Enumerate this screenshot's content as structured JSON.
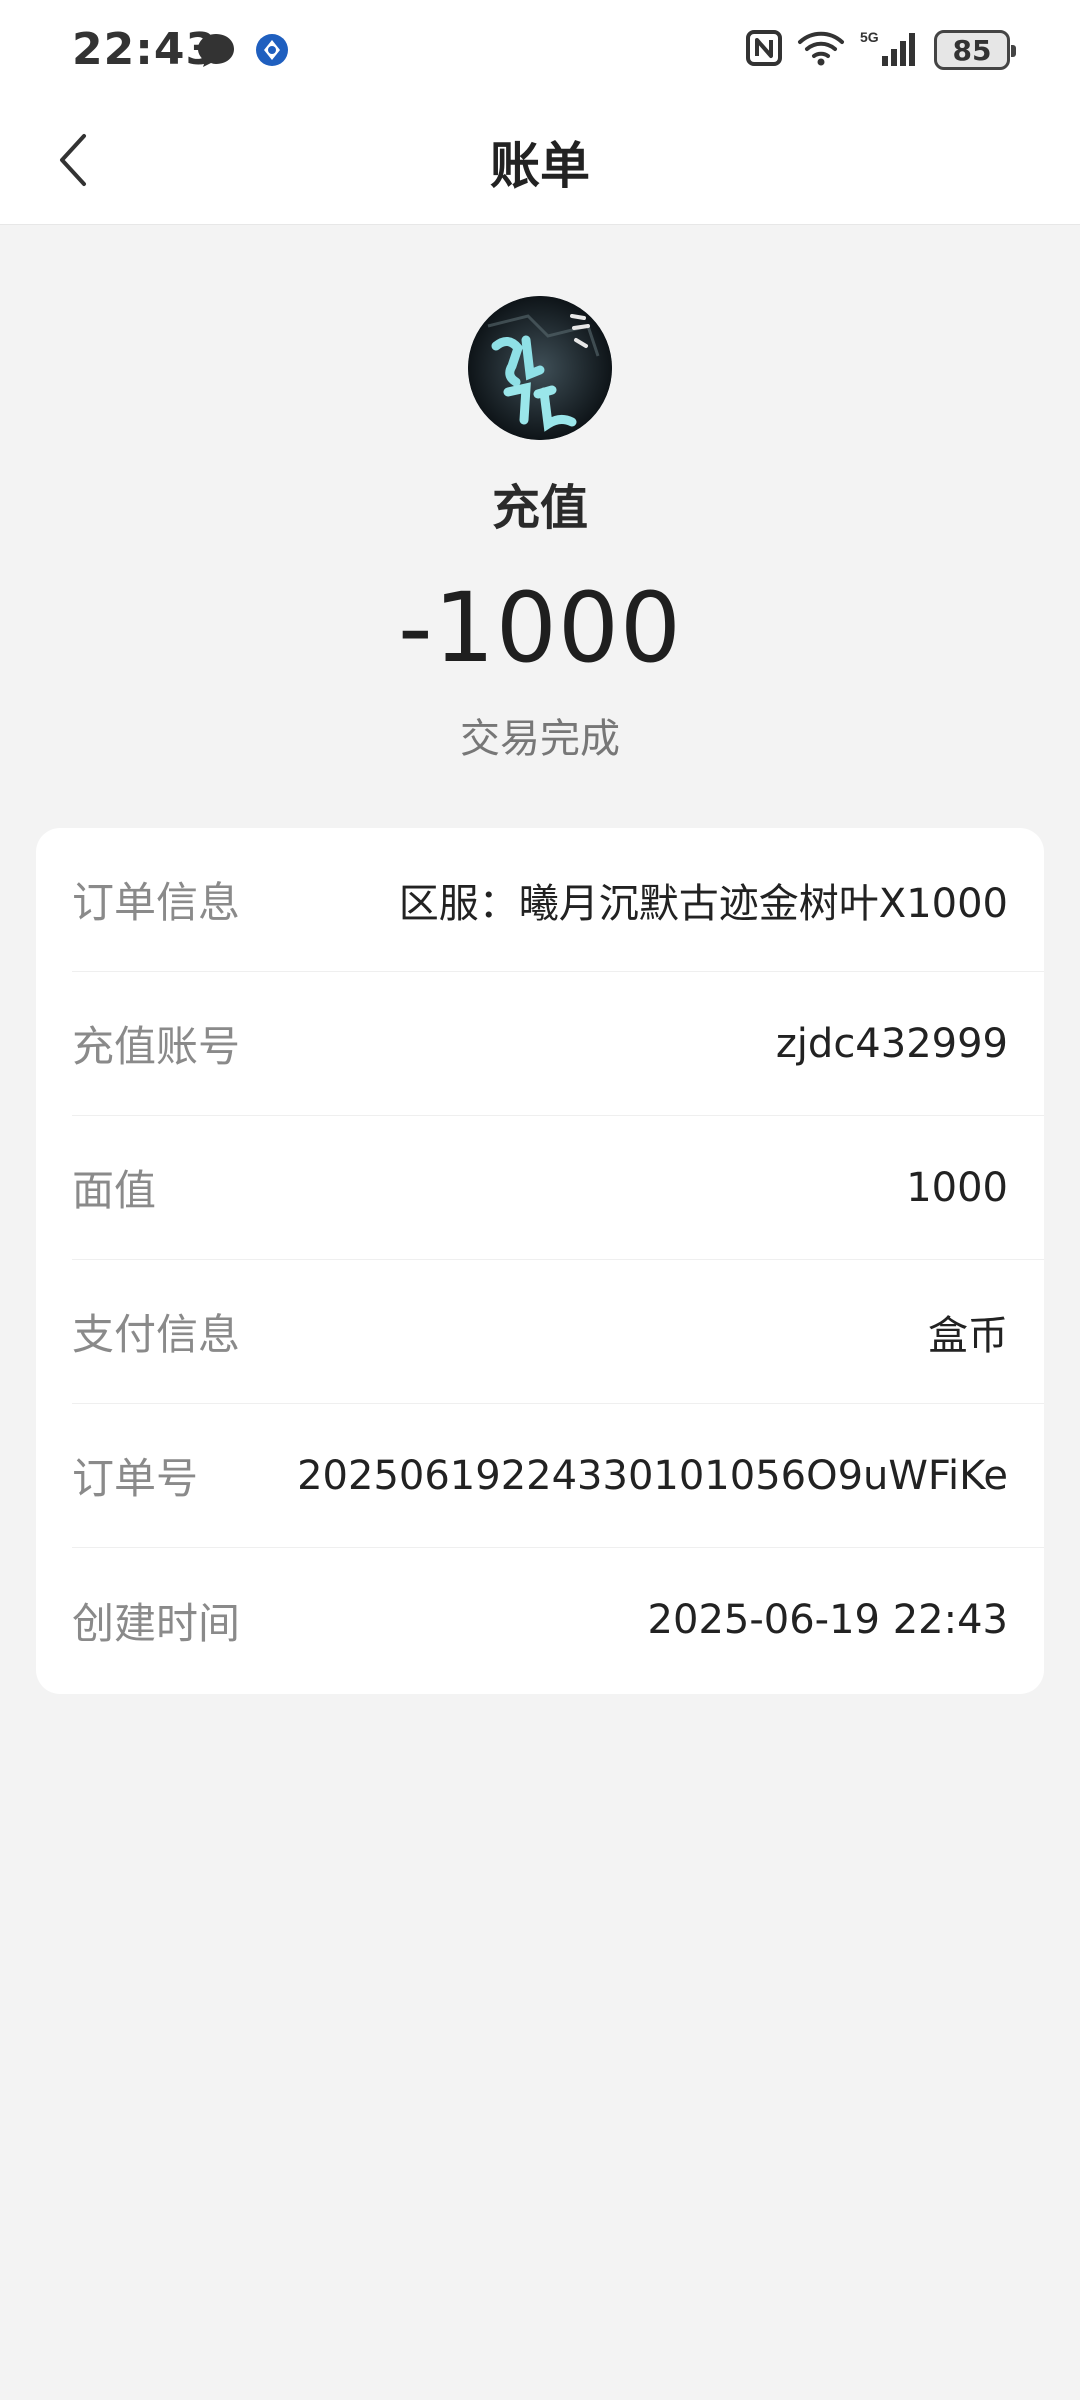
{
  "status_bar": {
    "time": "22:43",
    "battery": "85",
    "network": "5G"
  },
  "nav": {
    "title": "账单"
  },
  "summary": {
    "type": "充值",
    "amount": "-1000",
    "status": "交易完成"
  },
  "details": [
    {
      "label": "订单信息",
      "value": "区服：曦月沉默古迹金树叶X1000"
    },
    {
      "label": "充值账号",
      "value": "zjdc432999"
    },
    {
      "label": "面值",
      "value": "1000"
    },
    {
      "label": "支付信息",
      "value": "盒币"
    },
    {
      "label": "订单号",
      "value": "20250619224330101056O9uWFiKe"
    },
    {
      "label": "创建时间",
      "value": "2025-06-19 22:43"
    }
  ]
}
